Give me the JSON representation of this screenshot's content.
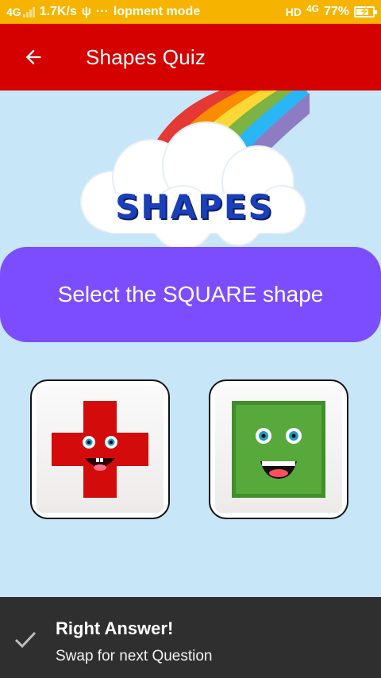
{
  "status_bar": {
    "network": "4G",
    "speed": "1.7K/s",
    "usb_symbol": "ψ",
    "dots": "···",
    "notification_text": "lopment mode",
    "hd": "HD",
    "net_type": "4G",
    "battery": "77%"
  },
  "app_bar": {
    "title": "Shapes Quiz",
    "back_icon": "arrow-back-icon"
  },
  "banner": {
    "text": "SHAPES"
  },
  "question": {
    "text": "Select the SQUARE shape"
  },
  "options": [
    {
      "shape": "cross",
      "color": "#d40b0b"
    },
    {
      "shape": "square",
      "color": "#58a93b"
    }
  ],
  "snackbar": {
    "icon": "check-icon",
    "title": "Right Answer!",
    "message": "Swap for next Question"
  },
  "colors": {
    "status_bar": "#f6b400",
    "app_bar": "#d50000",
    "background": "#c7e6f7",
    "question_card": "#7c4dff",
    "snackbar": "#2f2f2f"
  }
}
